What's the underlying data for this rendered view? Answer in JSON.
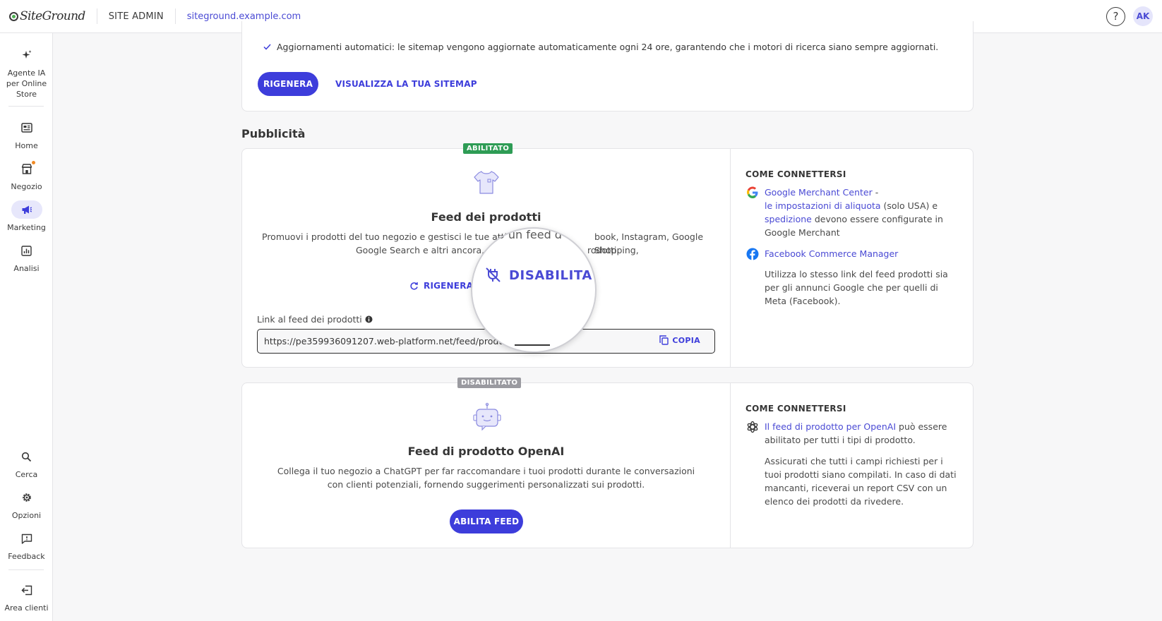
{
  "topbar": {
    "logo_text": "SiteGround",
    "section": "SITE ADMIN",
    "domain": "siteground.example.com",
    "help_label": "?",
    "avatar_initials": "AK"
  },
  "sidebar": {
    "items": [
      {
        "label": "Agente IA per Online Store",
        "icon": "sparkle-icon"
      },
      {
        "label": "Home",
        "icon": "dashboard-icon"
      },
      {
        "label": "Negozio",
        "icon": "store-icon"
      },
      {
        "label": "Marketing",
        "icon": "megaphone-icon",
        "active": true
      },
      {
        "label": "Analisi",
        "icon": "analytics-icon"
      },
      {
        "label": "Cerca",
        "icon": "search-icon"
      },
      {
        "label": "Opzioni",
        "icon": "gear-icon"
      },
      {
        "label": "Feedback",
        "icon": "feedback-icon"
      },
      {
        "label": "Area clienti",
        "icon": "logout-icon"
      }
    ]
  },
  "sitemap": {
    "auto_update_text": "Aggiornamenti automatici: le sitemap vengono aggiornate automaticamente ogni 24 ore, garantendo che i motori di ricerca siano sempre aggiornati.",
    "regenerate_label": "RIGENERA",
    "view_label": "VISUALIZZA LA TUA SITEMAP"
  },
  "advertising": {
    "section_title": "Pubblicità",
    "product_feed": {
      "badge": "ABILITATO",
      "title": "Feed dei prodotti",
      "description": "Promuovi i prodotti del tuo negozio e gestisci le tue attività su un feed di Facebook, Instagram, Google Shopping, Google Search e altri ancora, generando un feed dei tuoi prodotti.",
      "description_visible_line1": "Promuovi i prodotti del tuo negozio e gestisci le tue attività",
      "description_visible_line1b": "book, Instagram, Google Shopping,",
      "description_visible_line2": "Google Search e altri ancora, ge",
      "description_visible_line2b": "rodotti.",
      "regenerate_label": "RIGENERA",
      "disable_label": "DISABILITA",
      "magnified_text": "o un feed d",
      "link_label": "Link al feed dei prodotti",
      "link_value": "https://pe359936091207.web-platform.net/feed/products.",
      "copy_label": "COPIA",
      "how_title": "COME CONNETTERSI",
      "google_link1": "Google Merchant Center",
      "google_text1": " -",
      "google_link2": "le impostazioni di aliquota",
      "google_text2": " (solo USA) e",
      "google_link3": "spedizione",
      "google_text3": " devono essere configurate in Google Merchant",
      "facebook_link": "Facebook Commerce Manager",
      "shared_text": "Utilizza lo stesso link del feed prodotti sia per gli annunci Google che per quelli di Meta (Facebook)."
    },
    "openai_feed": {
      "badge": "DISABILITATO",
      "title": "Feed di prodotto OpenAI",
      "description": "Collega il tuo negozio a ChatGPT per far raccomandare i tuoi prodotti durante le conversazioni con clienti potenziali, fornendo suggerimenti personalizzati sui prodotti.",
      "enable_label": "ABILITA FEED",
      "how_title": "COME CONNETTERSI",
      "openai_link": "Il feed di prodotto per OpenAI",
      "openai_text": " può essere abilitato per tutti i tipi di prodotto.",
      "csv_text": "Assicurati che tutti i campi richiesti per i tuoi prodotti siano compilati. In caso di dati mancanti, riceverai un report CSV con un elenco dei prodotti da rivedere."
    }
  },
  "colors": {
    "primary": "#3d3ddb",
    "link": "#4a4ad4",
    "enabled_badge": "#2e9c55",
    "disabled_badge": "#9a9aa0",
    "notification_dot": "#f08a24"
  }
}
